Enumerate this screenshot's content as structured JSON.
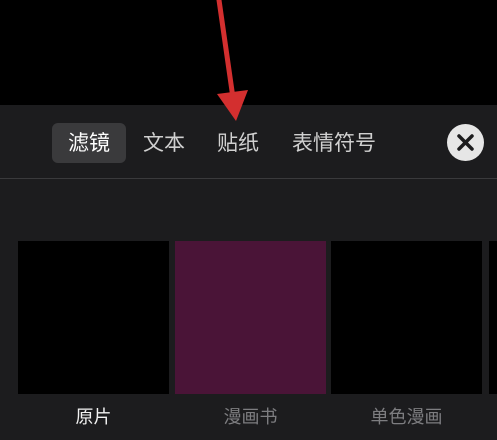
{
  "tabs": {
    "filter": "滤镜",
    "text": "文本",
    "sticker": "贴纸",
    "emoji": "表情符号"
  },
  "active_tab": "filter",
  "thumbnails": [
    {
      "label": "原片",
      "selected": true,
      "color": "#000000"
    },
    {
      "label": "漫画书",
      "selected": false,
      "color": "#4a1437"
    },
    {
      "label": "单色漫画",
      "selected": false,
      "color": "#000000"
    }
  ],
  "colors": {
    "background": "#000000",
    "panel": "#1c1c1e",
    "active_tab": "#3a3a3c",
    "annotation_arrow": "#d32f2f",
    "close_button": "#e6e6e6"
  },
  "icons": {
    "close": "close-icon",
    "arrow": "annotation-arrow-icon"
  }
}
